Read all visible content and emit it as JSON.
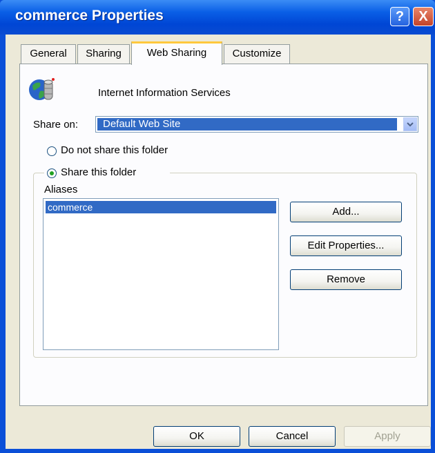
{
  "window": {
    "title": "commerce Properties",
    "help_label": "?",
    "close_label": "X"
  },
  "tabs": [
    {
      "label": "General"
    },
    {
      "label": "Sharing"
    },
    {
      "label": "Web Sharing"
    },
    {
      "label": "Customize"
    }
  ],
  "content": {
    "service_name": "Internet Information Services",
    "share_on_label": "Share on:",
    "share_on_value": "Default Web Site",
    "radio_do_not_share": "Do not share this folder",
    "radio_share": "Share this folder",
    "aliases_label": "Aliases",
    "aliases": [
      "commerce"
    ]
  },
  "buttons": {
    "add": "Add...",
    "edit_properties": "Edit Properties...",
    "remove": "Remove",
    "ok": "OK",
    "cancel": "Cancel",
    "apply": "Apply"
  },
  "colors": {
    "titlebar": "#0a4fd8",
    "selection": "#316ac5",
    "dialog_bg": "#ece9d8"
  }
}
